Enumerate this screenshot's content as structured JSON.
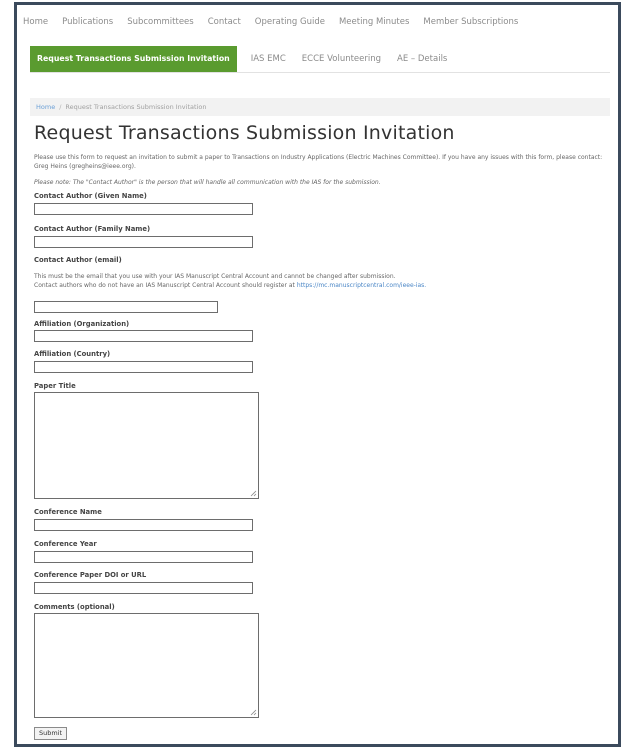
{
  "topnav": [
    "Home",
    "Publications",
    "Subcommittees",
    "Contact",
    "Operating Guide",
    "Meeting Minutes",
    "Member Subscriptions"
  ],
  "subnav": {
    "active": "Request Transactions Submission Invitation",
    "items": [
      "IAS EMC",
      "ECCE Volunteering",
      "AE – Details"
    ]
  },
  "breadcrumb": {
    "home": "Home",
    "sep": "/",
    "current": "Request Transactions Submission Invitation"
  },
  "page_title": "Request Transactions Submission Invitation",
  "intro": "Please use this form to request an invitation to submit a paper to Transactions on Industry Applications (Electric Machines Committee). If you have any issues with this form, please contact: Greg Heins (gregheins@ieee.org).",
  "note": "Please note: The \"Contact Author\" is the person that will handle all communication with the IAS for the submission.",
  "fields": {
    "given_name": "Contact Author (Given Name)",
    "family_name": "Contact Author (Family Name)",
    "email": "Contact Author (email)",
    "email_help_1": "This must be the email that you use with your IAS Manuscript Central Account and cannot be changed after submission.",
    "email_help_2": "Contact authors who do not have an IAS Manuscript Central Account should register at",
    "email_help_link": "https://mc.manuscriptcentral.com/ieee-ias.",
    "affiliation_org": "Affiliation (Organization)",
    "affiliation_country": "Affiliation (Country)",
    "paper_title": "Paper Title",
    "conference_name": "Conference Name",
    "conference_year": "Conference Year",
    "conference_doi": "Conference Paper DOI or URL",
    "comments": "Comments (optional)"
  },
  "submit_label": "Submit"
}
